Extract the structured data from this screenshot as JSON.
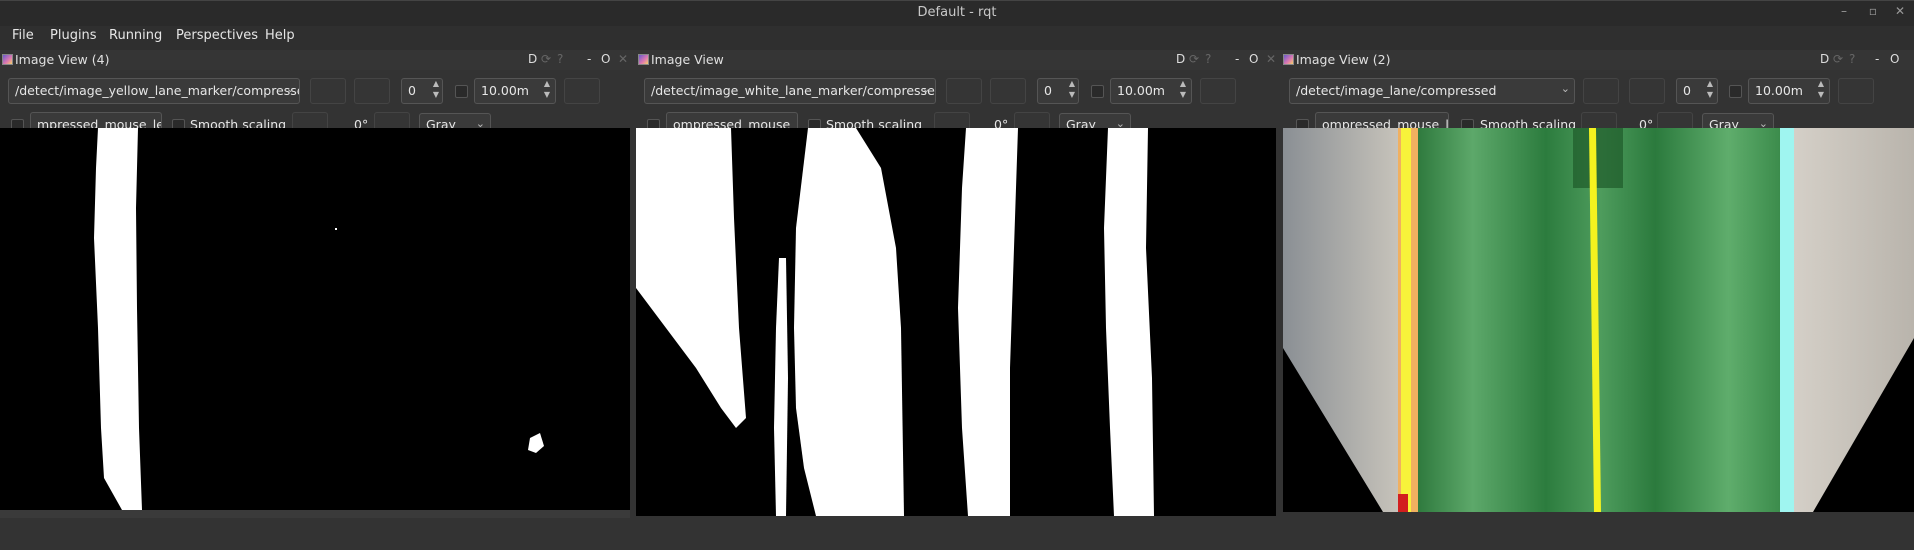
{
  "window": {
    "title": "Default - rqt",
    "controls": {
      "minimize": "–",
      "restore": "▫",
      "close": "✕"
    }
  },
  "menu": [
    "File",
    "Plugins",
    "Running",
    "Perspectives",
    "Help"
  ],
  "panels": [
    {
      "title": "Image View (4)",
      "topic": "/detect/image_yellow_lane_marker/compressed",
      "spin_value": "0",
      "duration": "10.00m",
      "mouse_topic": "mpressed_mouse_left",
      "smooth_label": "Smooth scaling",
      "rotation": "0°",
      "color_mode": "Gray",
      "dock_btn": "D",
      "close_btn": "O",
      "minus_btn": "-"
    },
    {
      "title": "Image View",
      "topic": "/detect/image_white_lane_marker/compressed",
      "spin_value": "0",
      "duration": "10.00m",
      "mouse_topic": "ompressed_mouse_left",
      "smooth_label": "Smooth scaling",
      "rotation": "0°",
      "color_mode": "Gray",
      "dock_btn": "D",
      "close_btn": "O",
      "minus_btn": "-"
    },
    {
      "title": "Image View (2)",
      "topic": "/detect/image_lane/compressed",
      "spin_value": "0",
      "duration": "10.00m",
      "mouse_topic": "ompressed_mouse_left",
      "smooth_label": "Smooth scaling",
      "rotation": "0°",
      "color_mode": "Gray",
      "dock_btn": "D",
      "close_btn": "O",
      "minus_btn": "-"
    }
  ]
}
